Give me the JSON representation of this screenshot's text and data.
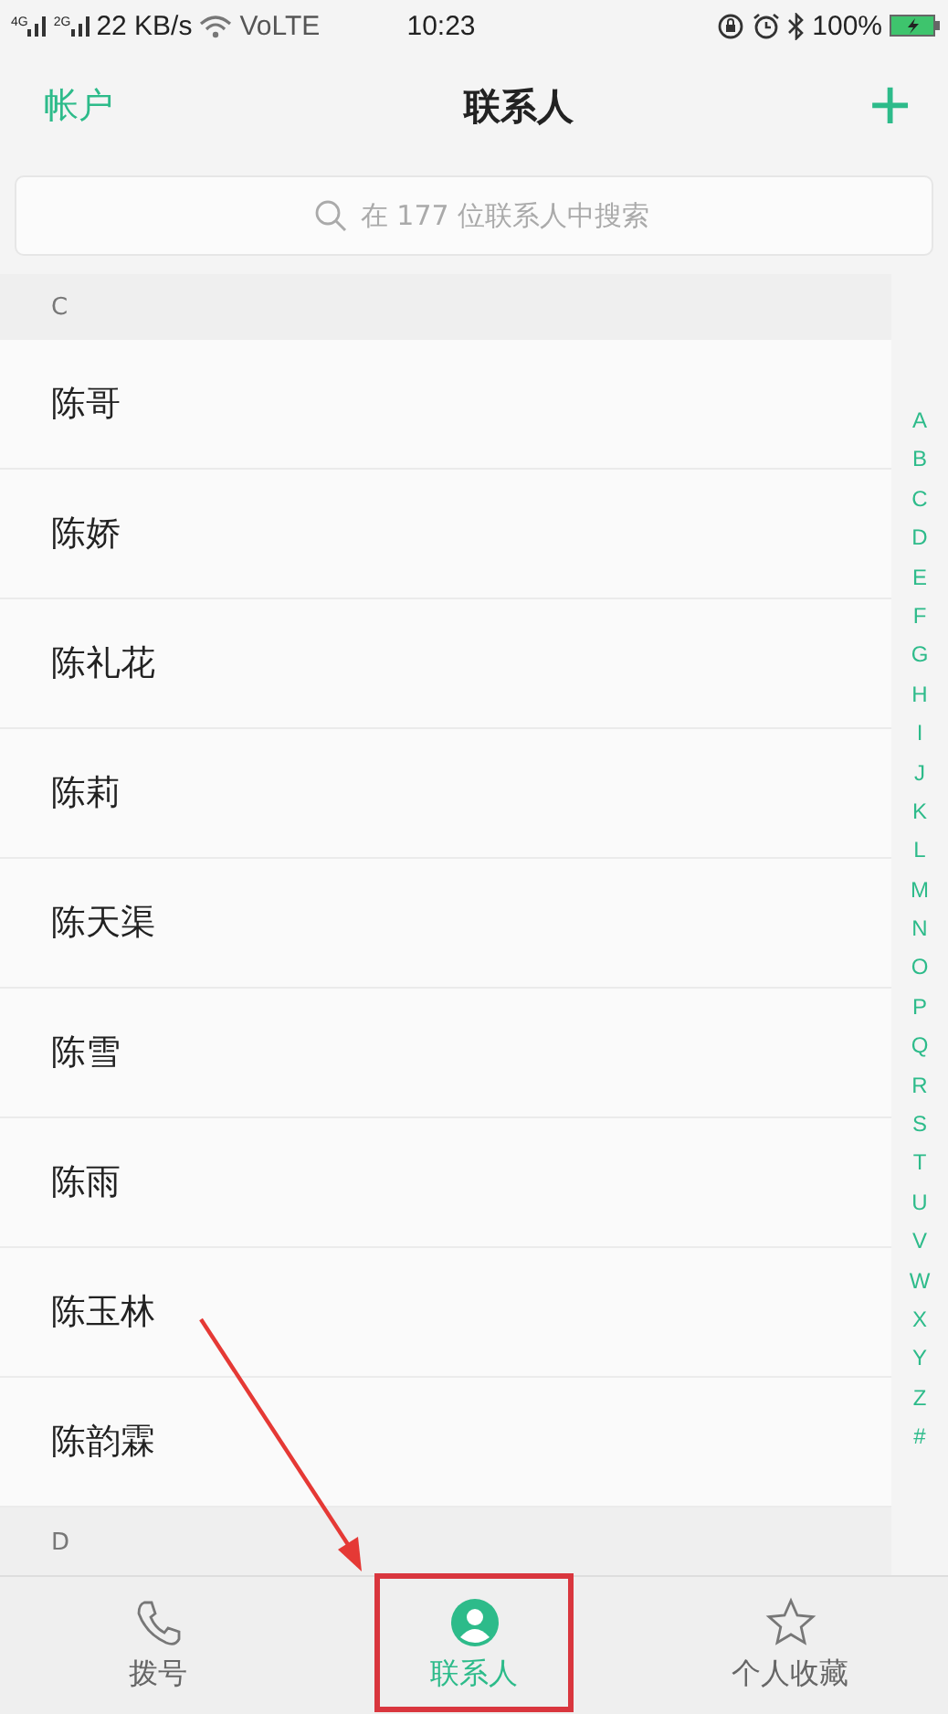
{
  "status_bar": {
    "signal_1": "4G",
    "signal_2": "2G",
    "speed": "22 KB/s",
    "network": "VoLTE",
    "time": "10:23",
    "battery": "100%"
  },
  "header": {
    "left": "帐户",
    "title": "联系人",
    "add": "+"
  },
  "search": {
    "placeholder": "在 177 位联系人中搜索"
  },
  "sections": [
    {
      "letter": "C",
      "contacts": [
        "陈哥",
        "陈娇",
        "陈礼花",
        "陈莉",
        "陈天渠",
        "陈雪",
        "陈雨",
        "陈玉林",
        "陈韵霖"
      ]
    },
    {
      "letter": "D"
    }
  ],
  "index": [
    "A",
    "B",
    "C",
    "D",
    "E",
    "F",
    "G",
    "H",
    "I",
    "J",
    "K",
    "L",
    "M",
    "N",
    "O",
    "P",
    "Q",
    "R",
    "S",
    "T",
    "U",
    "V",
    "W",
    "X",
    "Y",
    "Z",
    "#"
  ],
  "tabs": [
    {
      "label": "拨号",
      "kind": "phone",
      "selected": false,
      "highlighted": false
    },
    {
      "label": "联系人",
      "kind": "person",
      "selected": true,
      "highlighted": true
    },
    {
      "label": "个人收藏",
      "kind": "star",
      "selected": false,
      "highlighted": false
    }
  ],
  "annotation": {
    "kind": "arrow"
  }
}
